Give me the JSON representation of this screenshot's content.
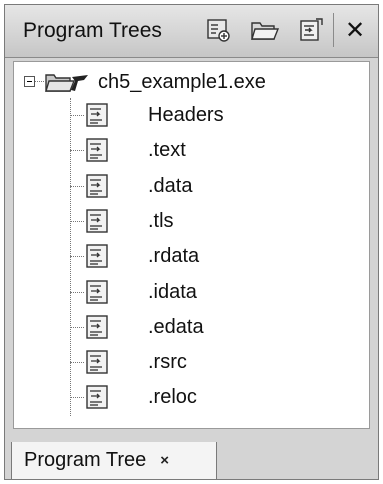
{
  "panel": {
    "title": "Program Trees",
    "toolbar": [
      {
        "name": "new-tree-icon"
      },
      {
        "name": "open-folder-icon"
      },
      {
        "name": "merge-tree-icon"
      },
      {
        "name": "close-icon",
        "glyph": "✕"
      }
    ]
  },
  "tree": {
    "root": {
      "label": "ch5_example1.exe",
      "icon": "program-folder-icon",
      "expanded": true
    },
    "children": [
      {
        "label": "Headers",
        "icon": "fragment-icon"
      },
      {
        "label": ".text",
        "icon": "fragment-icon"
      },
      {
        "label": ".data",
        "icon": "fragment-icon"
      },
      {
        "label": ".tls",
        "icon": "fragment-icon"
      },
      {
        "label": ".rdata",
        "icon": "fragment-icon"
      },
      {
        "label": ".idata",
        "icon": "fragment-icon"
      },
      {
        "label": ".edata",
        "icon": "fragment-icon"
      },
      {
        "label": ".rsrc",
        "icon": "fragment-icon"
      },
      {
        "label": ".reloc",
        "icon": "fragment-icon"
      }
    ]
  },
  "tabs": [
    {
      "label": "Program Tree",
      "close": "×"
    }
  ]
}
